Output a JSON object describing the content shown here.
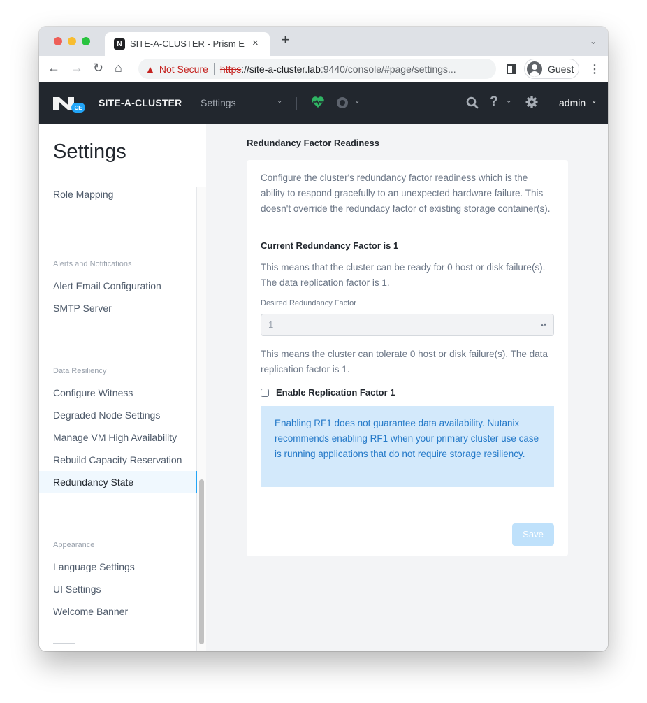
{
  "browser": {
    "tab_title": "SITE-A-CLUSTER - Prism Elem",
    "tab_favicon": "N",
    "tab_close": "×",
    "new_tab": "+",
    "tab_list_chevron": "⌄",
    "nav": {
      "back": "←",
      "forward": "→",
      "reload": "↻",
      "home": "⌂"
    },
    "security_warning_icon": "▲",
    "security_label": "Not Secure",
    "url_scheme": "https",
    "url_host": "://site-a-cluster.lab",
    "url_path": ":9440/console/#page/settings...",
    "profile_name": "Guest",
    "menu_icon": "⋮"
  },
  "header": {
    "logo_badge": "CE",
    "cluster_name": "SITE-A-CLUSTER",
    "page_menu": "Settings",
    "chevron": "⌄",
    "health_status_color": "#2fb463",
    "help_icon": "?",
    "user": "admin"
  },
  "sidebar": {
    "title": "Settings",
    "items": [
      {
        "label": "Role Mapping"
      },
      {
        "group": "Alerts and Notifications"
      },
      {
        "label": "Alert Email Configuration"
      },
      {
        "label": "SMTP Server"
      },
      {
        "group": "Data Resiliency"
      },
      {
        "label": "Configure Witness"
      },
      {
        "label": "Degraded Node Settings"
      },
      {
        "label": "Manage VM High Availability"
      },
      {
        "label": "Rebuild Capacity Reservation"
      },
      {
        "label": "Redundancy State",
        "active": true
      },
      {
        "group": "Appearance"
      },
      {
        "label": "Language Settings"
      },
      {
        "label": "UI Settings"
      },
      {
        "label": "Welcome Banner"
      }
    ]
  },
  "main": {
    "title": "Redundancy Factor Readiness",
    "description": "Configure the cluster's redundancy factor readiness which is the ability to respond gracefully to an unexpected hardware failure. This doesn't override the redundacy factor of existing storage container(s).",
    "current_rf": "Current Redundancy Factor is 1",
    "current_rf_desc": "This means that the cluster can be ready for 0 host or disk failure(s). The data replication factor is 1.",
    "desired_rf_label": "Desired Redundancy Factor",
    "desired_rf_value": "1",
    "select_arrow": "▴▾",
    "desired_rf_desc": "This means the cluster can tolerate 0 host or disk failure(s). The data replication factor is 1.",
    "enable_rf1_label": "Enable Replication Factor 1",
    "enable_rf1_checked": false,
    "info_message": "Enabling RF1 does not guarantee data availability. Nutanix recommends enabling RF1 when your primary cluster use case is running applications that do not require storage resiliency.",
    "save_label": "Save",
    "save_enabled": false
  },
  "colors": {
    "accent": "#22a5f7",
    "header_bg": "#22272e",
    "info_bg": "#d3e9fb",
    "info_text": "#2479c8",
    "warning": "#c5221f"
  }
}
